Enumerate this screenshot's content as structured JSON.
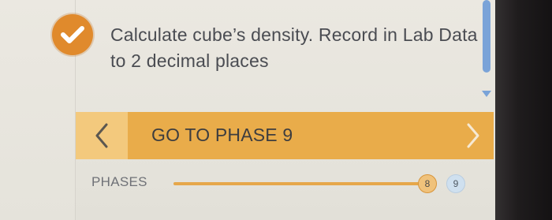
{
  "task": {
    "status_icon": "check-icon",
    "text": "Calculate cube’s density. Record in Lab Data to 2 decimal places"
  },
  "phase_nav": {
    "prev_icon": "chevron-left-icon",
    "next_icon": "chevron-right-icon",
    "label": "GO TO PHASE 9"
  },
  "phases": {
    "label": "PHASES",
    "items": [
      "8",
      "9"
    ],
    "current": "8"
  },
  "colors": {
    "accent_orange": "#e9ac4a",
    "check_circle": "#e08a2c",
    "scrollbar": "#7aa3d8"
  }
}
